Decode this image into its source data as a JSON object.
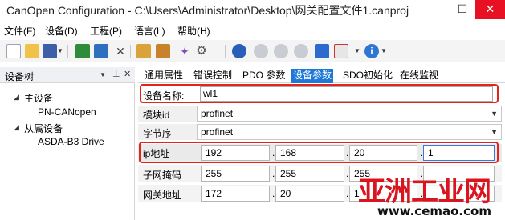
{
  "window": {
    "title": "CanOpen Configuration - C:\\Users\\Administrator\\Desktop\\网关配置文件1.canproj",
    "min_glyph": "—",
    "max_glyph": "☐",
    "close_glyph": "✕"
  },
  "menu": [
    "文件(F)",
    "设备(D)",
    "工程(P)",
    "语言(L)",
    "帮助(H)"
  ],
  "toolbar": {
    "icons": [
      "new-file-icon",
      "open-folder-icon",
      "save-icon",
      "save-dropdown-icon",
      "add-device-icon",
      "remove-device-icon",
      "delete-icon",
      "import-icon",
      "export-icon",
      "wand-icon",
      "settings-icon",
      "connect-icon",
      "play-icon",
      "pause-icon",
      "stop-icon",
      "download-icon",
      "clear-icon",
      "info-icon"
    ]
  },
  "device_tree": {
    "title": "设备树",
    "pin_glyph": "ᵖ",
    "close_glyph": "✕",
    "master_label": "主设备",
    "master_child": "PN-CANopen",
    "slave_label": "从属设备",
    "slave_child": "ASDA-B3 Drive"
  },
  "tabs": [
    "通用属性",
    "错误控制",
    "PDO 参数",
    "设备参数",
    "SDO初始化",
    "在线监视"
  ],
  "active_tab_index": 3,
  "form": {
    "device_name_label": "设备名称:",
    "device_name_value": "wl1",
    "module_id_label": "模块id",
    "module_id_value": "profinet",
    "byte_order_label": "字节序",
    "byte_order_value": "profinet",
    "ip_label": "ip地址",
    "ip": [
      "192",
      "168",
      "20",
      "1"
    ],
    "subnet_label": "子网掩码",
    "subnet": [
      "255",
      "255",
      "255",
      ""
    ],
    "gateway_label": "网关地址",
    "gateway": [
      "172",
      "20",
      "1",
      ""
    ]
  },
  "watermark": {
    "brand": "亚洲工业网",
    "url": "www.cemao.com"
  },
  "colors": {
    "active_tab": "#1e78d7",
    "highlight": "#e5231b",
    "watermark": "#d9161f"
  }
}
